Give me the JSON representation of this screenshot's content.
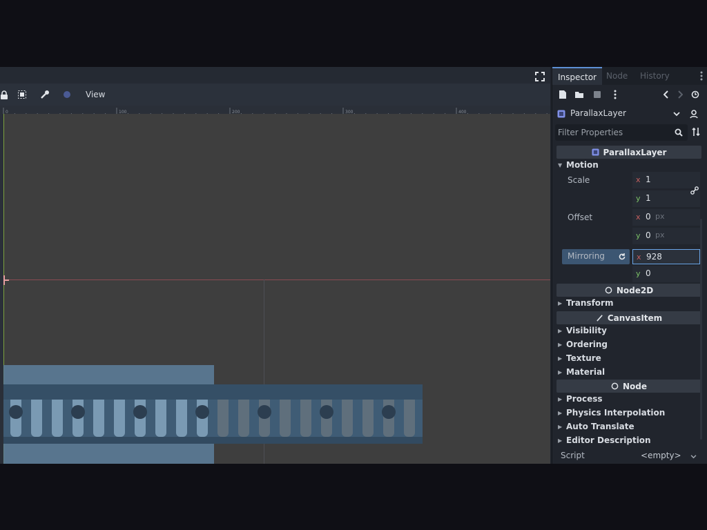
{
  "viewport": {
    "toolbar": {
      "view_label": "View",
      "icons": [
        "lock-icon",
        "group-select-icon",
        "wrench-icon",
        "snap-icon"
      ]
    },
    "ruler_ticks": [
      "0",
      "100",
      "200",
      "300",
      "400"
    ]
  },
  "inspector": {
    "tabs": [
      {
        "label": "Inspector",
        "active": true
      },
      {
        "label": "Node",
        "active": false
      },
      {
        "label": "History",
        "active": false
      }
    ],
    "object_name": "ParallaxLayer",
    "filter_placeholder": "Filter Properties",
    "sections": {
      "parallax_layer": "ParallaxLayer",
      "node2d": "Node2D",
      "canvas_item": "CanvasItem",
      "node": "Node"
    },
    "motion": {
      "group_label": "Motion",
      "scale": {
        "label": "Scale",
        "x": "1",
        "y": "1"
      },
      "offset": {
        "label": "Offset",
        "x": "0",
        "y": "0",
        "unit": "px"
      },
      "mirroring": {
        "label": "Mirroring",
        "x": "928",
        "y": "0"
      }
    },
    "groups": {
      "transform": "Transform",
      "visibility": "Visibility",
      "ordering": "Ordering",
      "texture": "Texture",
      "material": "Material",
      "process": "Process",
      "physics_interpolation": "Physics Interpolation",
      "auto_translate": "Auto Translate",
      "editor_description": "Editor Description"
    },
    "script": {
      "label": "Script",
      "value": "<empty>"
    }
  },
  "colors": {
    "accent": "#5e90d6",
    "x_axis": "#c65f5f",
    "y_axis": "#7cc267",
    "highlight": "#3c5672"
  }
}
